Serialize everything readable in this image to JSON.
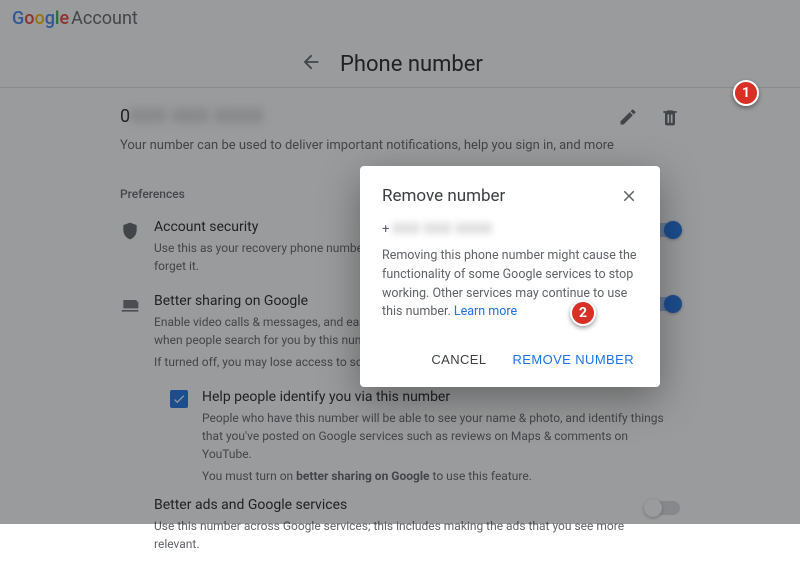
{
  "brand": {
    "account_word": "Account"
  },
  "page": {
    "title": "Phone number",
    "number_prefix": "0",
    "number_blurred": "XXX XXX XXXX",
    "subtext": "Your number can be used to deliver important notifications, help you sign in, and more"
  },
  "prefs": {
    "label": "Preferences",
    "security": {
      "title": "Account security",
      "desc": "Use this as your recovery phone number to help you sign in or reset your password if you forget it."
    },
    "sharing": {
      "title": "Better sharing on Google",
      "desc": "Enable video calls & messages, and easier sharing of photos & files on Google services when people search for you by this number.",
      "off_note": "If turned off, you may lose access to some of these features."
    },
    "identify": {
      "title": "Help people identify you via this number",
      "desc": "People who have this number will be able to see your name & photo, and identify things that you've posted on Google services such as reviews on Maps & comments on YouTube.",
      "must_prefix": "You must turn on ",
      "must_bold": "better sharing on Google",
      "must_suffix": " to use this feature."
    },
    "ads": {
      "title": "Better ads and Google services",
      "desc": "Use this number across Google services; this includes making the ads that you see more relevant."
    }
  },
  "dialog": {
    "title": "Remove number",
    "num_prefix": "+",
    "num_blurred": "XXX XXX XXXX",
    "body": "Removing this phone number might cause the functionality of some Google services to stop working. Other services may continue to use this number. ",
    "learn_more": "Learn more",
    "cancel": "CANCEL",
    "confirm": "REMOVE NUMBER"
  },
  "callouts": {
    "one": "1",
    "two": "2"
  }
}
